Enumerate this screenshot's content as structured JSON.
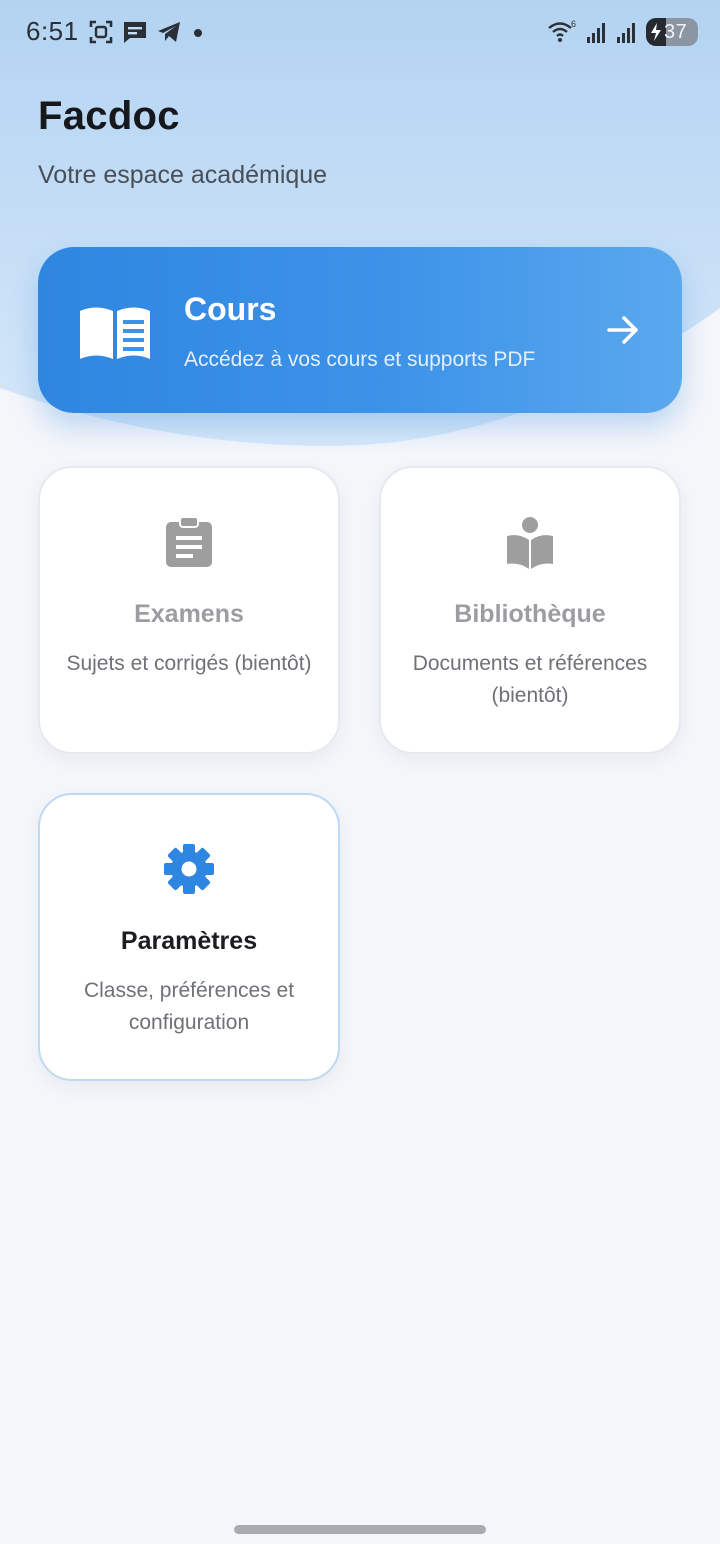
{
  "status_bar": {
    "time": "6:51",
    "battery_level": "37",
    "left_icons": [
      "screenshot-icon",
      "message-icon",
      "telegram-icon",
      "dot-icon"
    ],
    "right_icons": [
      "wifi-icon",
      "signal-icon",
      "signal-icon",
      "battery-charging-icon"
    ],
    "wifi_superscript": "6"
  },
  "header": {
    "title": "Facdoc",
    "subtitle": "Votre espace académique"
  },
  "cours_card": {
    "icon": "open-book-icon",
    "title": "Cours",
    "description": "Accédez à vos cours et supports PDF",
    "arrow_icon": "arrow-right-icon",
    "color": "#2f86e0"
  },
  "tiles": [
    {
      "name": "examens",
      "icon": "clipboard-icon",
      "title": "Examens",
      "description": "Sujets et corrigés (bientôt)",
      "enabled": false
    },
    {
      "name": "bibliotheque",
      "icon": "reader-book-icon",
      "title": "Bibliothèque",
      "description": "Documents et références (bientôt)",
      "enabled": false
    },
    {
      "name": "parametres",
      "icon": "gear-icon",
      "title": "Paramètres",
      "description": "Classe, préférences et configuration",
      "enabled": true
    }
  ],
  "colors": {
    "accent": "#2f86e0",
    "disabled_icon": "#9e9e9e",
    "background": "#f4f6fa"
  }
}
